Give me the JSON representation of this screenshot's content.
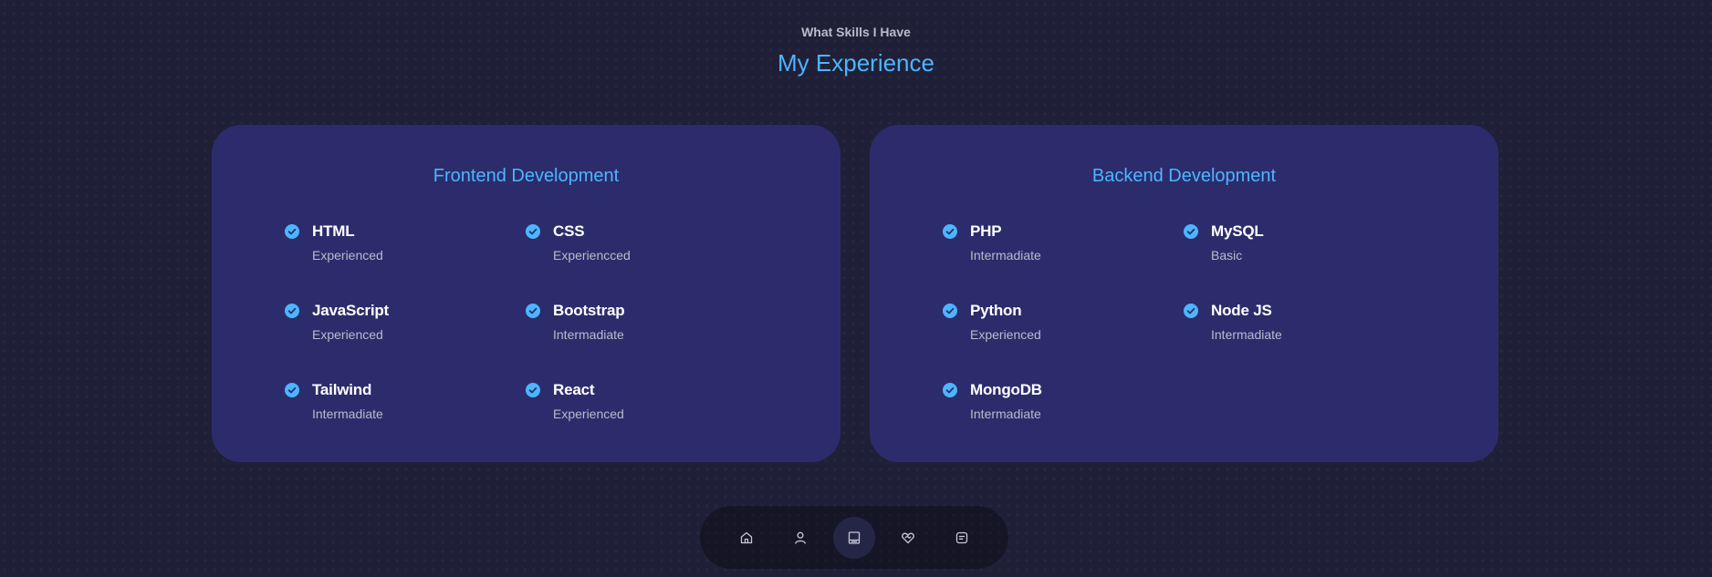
{
  "header": {
    "subtitle": "What Skills I Have",
    "title": "My Experience"
  },
  "frontend": {
    "title": "Frontend Development",
    "skills": [
      {
        "name": "HTML",
        "level": "Experienced"
      },
      {
        "name": "CSS",
        "level": "Experiencced"
      },
      {
        "name": "JavaScript",
        "level": "Experienced"
      },
      {
        "name": "Bootstrap",
        "level": "Intermadiate"
      },
      {
        "name": "Tailwind",
        "level": "Intermadiate"
      },
      {
        "name": "React",
        "level": "Experienced"
      }
    ]
  },
  "backend": {
    "title": "Backend Development",
    "skills": [
      {
        "name": "PHP",
        "level": "Intermadiate"
      },
      {
        "name": "MySQL",
        "level": "Basic"
      },
      {
        "name": "Python",
        "level": "Experienced"
      },
      {
        "name": "Node JS",
        "level": "Intermadiate"
      },
      {
        "name": "MongoDB",
        "level": "Intermadiate"
      }
    ]
  },
  "nav": {
    "items": [
      {
        "icon": "home-icon",
        "active": false
      },
      {
        "icon": "user-icon",
        "active": false
      },
      {
        "icon": "book-icon",
        "active": true
      },
      {
        "icon": "heart-handshake-icon",
        "active": false
      },
      {
        "icon": "message-icon",
        "active": false
      }
    ]
  },
  "colors": {
    "background": "#1f1f38",
    "card": "#2c2c6c",
    "accent": "#4db5ff",
    "muted_text": "#b9bccb"
  }
}
